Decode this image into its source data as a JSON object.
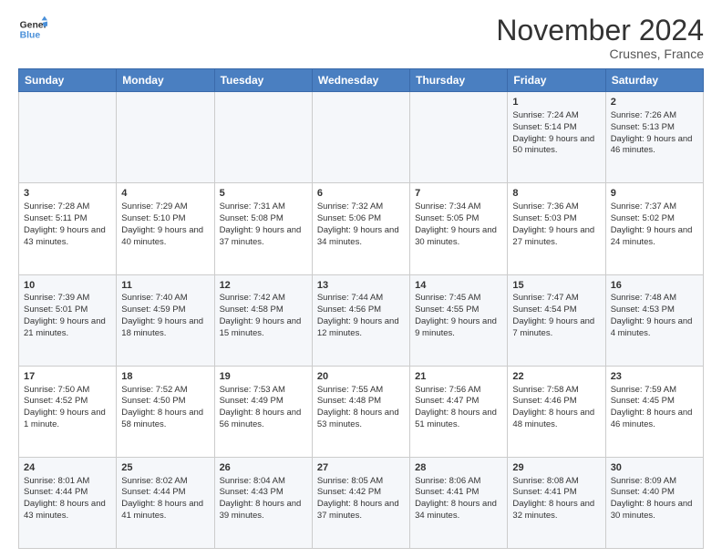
{
  "header": {
    "logo_line1": "General",
    "logo_line2": "Blue",
    "month": "November 2024",
    "location": "Crusnes, France"
  },
  "days_of_week": [
    "Sunday",
    "Monday",
    "Tuesday",
    "Wednesday",
    "Thursday",
    "Friday",
    "Saturday"
  ],
  "weeks": [
    [
      {
        "day": "",
        "info": ""
      },
      {
        "day": "",
        "info": ""
      },
      {
        "day": "",
        "info": ""
      },
      {
        "day": "",
        "info": ""
      },
      {
        "day": "",
        "info": ""
      },
      {
        "day": "1",
        "info": "Sunrise: 7:24 AM\nSunset: 5:14 PM\nDaylight: 9 hours and 50 minutes."
      },
      {
        "day": "2",
        "info": "Sunrise: 7:26 AM\nSunset: 5:13 PM\nDaylight: 9 hours and 46 minutes."
      }
    ],
    [
      {
        "day": "3",
        "info": "Sunrise: 7:28 AM\nSunset: 5:11 PM\nDaylight: 9 hours and 43 minutes."
      },
      {
        "day": "4",
        "info": "Sunrise: 7:29 AM\nSunset: 5:10 PM\nDaylight: 9 hours and 40 minutes."
      },
      {
        "day": "5",
        "info": "Sunrise: 7:31 AM\nSunset: 5:08 PM\nDaylight: 9 hours and 37 minutes."
      },
      {
        "day": "6",
        "info": "Sunrise: 7:32 AM\nSunset: 5:06 PM\nDaylight: 9 hours and 34 minutes."
      },
      {
        "day": "7",
        "info": "Sunrise: 7:34 AM\nSunset: 5:05 PM\nDaylight: 9 hours and 30 minutes."
      },
      {
        "day": "8",
        "info": "Sunrise: 7:36 AM\nSunset: 5:03 PM\nDaylight: 9 hours and 27 minutes."
      },
      {
        "day": "9",
        "info": "Sunrise: 7:37 AM\nSunset: 5:02 PM\nDaylight: 9 hours and 24 minutes."
      }
    ],
    [
      {
        "day": "10",
        "info": "Sunrise: 7:39 AM\nSunset: 5:01 PM\nDaylight: 9 hours and 21 minutes."
      },
      {
        "day": "11",
        "info": "Sunrise: 7:40 AM\nSunset: 4:59 PM\nDaylight: 9 hours and 18 minutes."
      },
      {
        "day": "12",
        "info": "Sunrise: 7:42 AM\nSunset: 4:58 PM\nDaylight: 9 hours and 15 minutes."
      },
      {
        "day": "13",
        "info": "Sunrise: 7:44 AM\nSunset: 4:56 PM\nDaylight: 9 hours and 12 minutes."
      },
      {
        "day": "14",
        "info": "Sunrise: 7:45 AM\nSunset: 4:55 PM\nDaylight: 9 hours and 9 minutes."
      },
      {
        "day": "15",
        "info": "Sunrise: 7:47 AM\nSunset: 4:54 PM\nDaylight: 9 hours and 7 minutes."
      },
      {
        "day": "16",
        "info": "Sunrise: 7:48 AM\nSunset: 4:53 PM\nDaylight: 9 hours and 4 minutes."
      }
    ],
    [
      {
        "day": "17",
        "info": "Sunrise: 7:50 AM\nSunset: 4:52 PM\nDaylight: 9 hours and 1 minute."
      },
      {
        "day": "18",
        "info": "Sunrise: 7:52 AM\nSunset: 4:50 PM\nDaylight: 8 hours and 58 minutes."
      },
      {
        "day": "19",
        "info": "Sunrise: 7:53 AM\nSunset: 4:49 PM\nDaylight: 8 hours and 56 minutes."
      },
      {
        "day": "20",
        "info": "Sunrise: 7:55 AM\nSunset: 4:48 PM\nDaylight: 8 hours and 53 minutes."
      },
      {
        "day": "21",
        "info": "Sunrise: 7:56 AM\nSunset: 4:47 PM\nDaylight: 8 hours and 51 minutes."
      },
      {
        "day": "22",
        "info": "Sunrise: 7:58 AM\nSunset: 4:46 PM\nDaylight: 8 hours and 48 minutes."
      },
      {
        "day": "23",
        "info": "Sunrise: 7:59 AM\nSunset: 4:45 PM\nDaylight: 8 hours and 46 minutes."
      }
    ],
    [
      {
        "day": "24",
        "info": "Sunrise: 8:01 AM\nSunset: 4:44 PM\nDaylight: 8 hours and 43 minutes."
      },
      {
        "day": "25",
        "info": "Sunrise: 8:02 AM\nSunset: 4:44 PM\nDaylight: 8 hours and 41 minutes."
      },
      {
        "day": "26",
        "info": "Sunrise: 8:04 AM\nSunset: 4:43 PM\nDaylight: 8 hours and 39 minutes."
      },
      {
        "day": "27",
        "info": "Sunrise: 8:05 AM\nSunset: 4:42 PM\nDaylight: 8 hours and 37 minutes."
      },
      {
        "day": "28",
        "info": "Sunrise: 8:06 AM\nSunset: 4:41 PM\nDaylight: 8 hours and 34 minutes."
      },
      {
        "day": "29",
        "info": "Sunrise: 8:08 AM\nSunset: 4:41 PM\nDaylight: 8 hours and 32 minutes."
      },
      {
        "day": "30",
        "info": "Sunrise: 8:09 AM\nSunset: 4:40 PM\nDaylight: 8 hours and 30 minutes."
      }
    ]
  ]
}
